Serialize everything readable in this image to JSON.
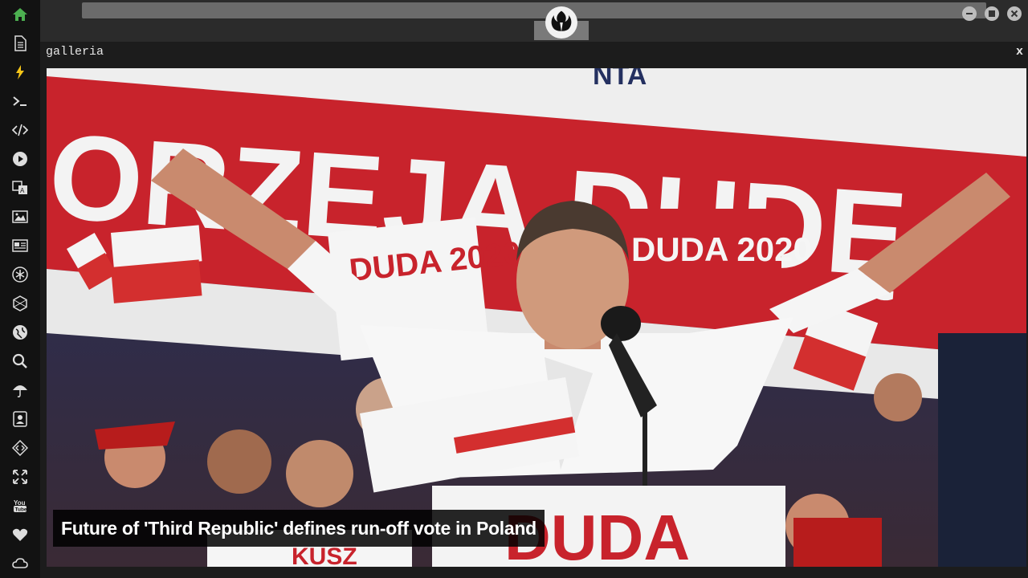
{
  "panel": {
    "title": "galleria",
    "close_label": "x"
  },
  "gallery": {
    "caption": "Future of 'Third Republic' defines run-off vote in Poland",
    "banner_text": "ORZEJA DUDĘ",
    "banner_top_text": "NTA",
    "sign_1": "DUDA 2020",
    "sign_2": "DUDA 2020",
    "sign_3": "DUDA",
    "sign_4": "KUSZ"
  },
  "sidebar": {
    "items": [
      {
        "name": "home-icon",
        "color": "#4caf50"
      },
      {
        "name": "document-icon"
      },
      {
        "name": "lightning-icon",
        "color": "#f5c518"
      },
      {
        "name": "terminal-icon"
      },
      {
        "name": "code-icon"
      },
      {
        "name": "play-icon"
      },
      {
        "name": "translate-icon"
      },
      {
        "name": "image-icon"
      },
      {
        "name": "news-icon"
      },
      {
        "name": "asterisk-icon"
      },
      {
        "name": "hexagon-icon"
      },
      {
        "name": "globe-icon"
      },
      {
        "name": "search-icon"
      },
      {
        "name": "umbrella-icon"
      },
      {
        "name": "contact-card-icon"
      },
      {
        "name": "diamond-code-icon"
      },
      {
        "name": "expand-icon"
      },
      {
        "name": "youtube-icon"
      },
      {
        "name": "heart-icon"
      },
      {
        "name": "cloud-icon"
      }
    ]
  },
  "colors": {
    "accent_green": "#4caf50",
    "banner_red": "#c8232c",
    "sidebar_bg": "#121212"
  }
}
